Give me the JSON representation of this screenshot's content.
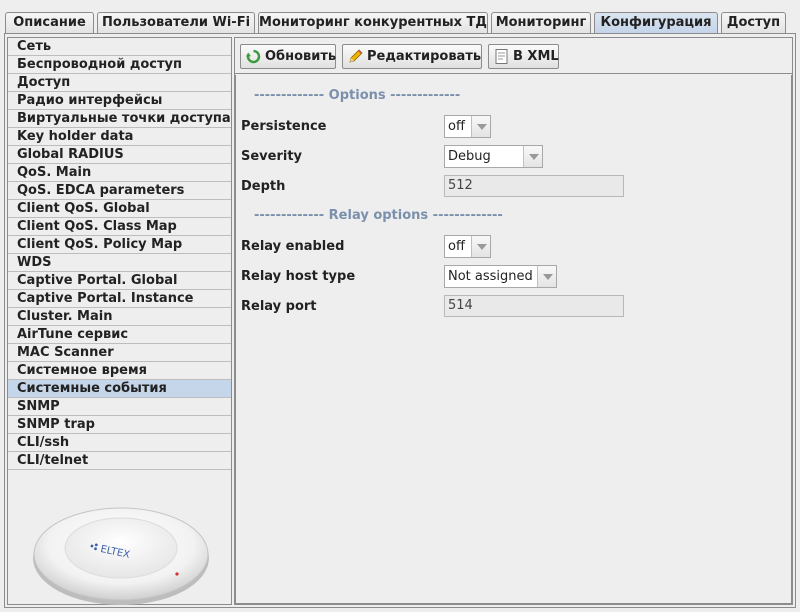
{
  "tabs": [
    {
      "label": "Описание",
      "active": false
    },
    {
      "label": "Пользователи Wi-Fi",
      "active": false
    },
    {
      "label": "Мониторинг конкурентных ТД",
      "active": false
    },
    {
      "label": "Мониторинг",
      "active": false
    },
    {
      "label": "Конфигурация",
      "active": true
    },
    {
      "label": "Доступ",
      "active": false
    }
  ],
  "sidebar": {
    "items": [
      {
        "label": "Сеть",
        "active": false
      },
      {
        "label": "Беспроводной доступ",
        "active": false
      },
      {
        "label": "Доступ",
        "active": false
      },
      {
        "label": "Радио интерфейсы",
        "active": false
      },
      {
        "label": "Виртуальные точки доступа",
        "active": false
      },
      {
        "label": "Key holder data",
        "active": false
      },
      {
        "label": "Global RADIUS",
        "active": false
      },
      {
        "label": "QoS. Main",
        "active": false
      },
      {
        "label": "QoS. EDCA parameters",
        "active": false
      },
      {
        "label": "Client QoS. Global",
        "active": false
      },
      {
        "label": "Client QoS. Class Map",
        "active": false
      },
      {
        "label": "Client QoS. Policy Map",
        "active": false
      },
      {
        "label": "WDS",
        "active": false
      },
      {
        "label": "Captive Portal. Global",
        "active": false
      },
      {
        "label": "Captive Portal. Instance",
        "active": false
      },
      {
        "label": "Cluster. Main",
        "active": false
      },
      {
        "label": "AirTune сервис",
        "active": false
      },
      {
        "label": "MAC Scanner",
        "active": false
      },
      {
        "label": "Системное время",
        "active": false
      },
      {
        "label": "Системные события",
        "active": true
      },
      {
        "label": "SNMP",
        "active": false
      },
      {
        "label": "SNMP trap",
        "active": false
      },
      {
        "label": "CLI/ssh",
        "active": false
      },
      {
        "label": "CLI/telnet",
        "active": false
      }
    ],
    "device_logo": "ELTEX"
  },
  "toolbar": {
    "refresh_label": "Обновить",
    "edit_label": "Редактировать",
    "xml_label": "В XML"
  },
  "form": {
    "options_section": "------------- Options -------------",
    "persistence_label": "Persistence",
    "persistence_value": "off",
    "severity_label": "Severity",
    "severity_value": "Debug",
    "depth_label": "Depth",
    "depth_value": "512",
    "relay_section": "------------- Relay options -------------",
    "relay_enabled_label": "Relay enabled",
    "relay_enabled_value": "off",
    "relay_host_type_label": "Relay host type",
    "relay_host_type_value": "Not assigned",
    "relay_port_label": "Relay port",
    "relay_port_value": "514"
  },
  "colors": {
    "active_tab": "#c3d3e8",
    "active_sidebar_item": "#c6d6ea",
    "section_label": "#7b90ac"
  }
}
